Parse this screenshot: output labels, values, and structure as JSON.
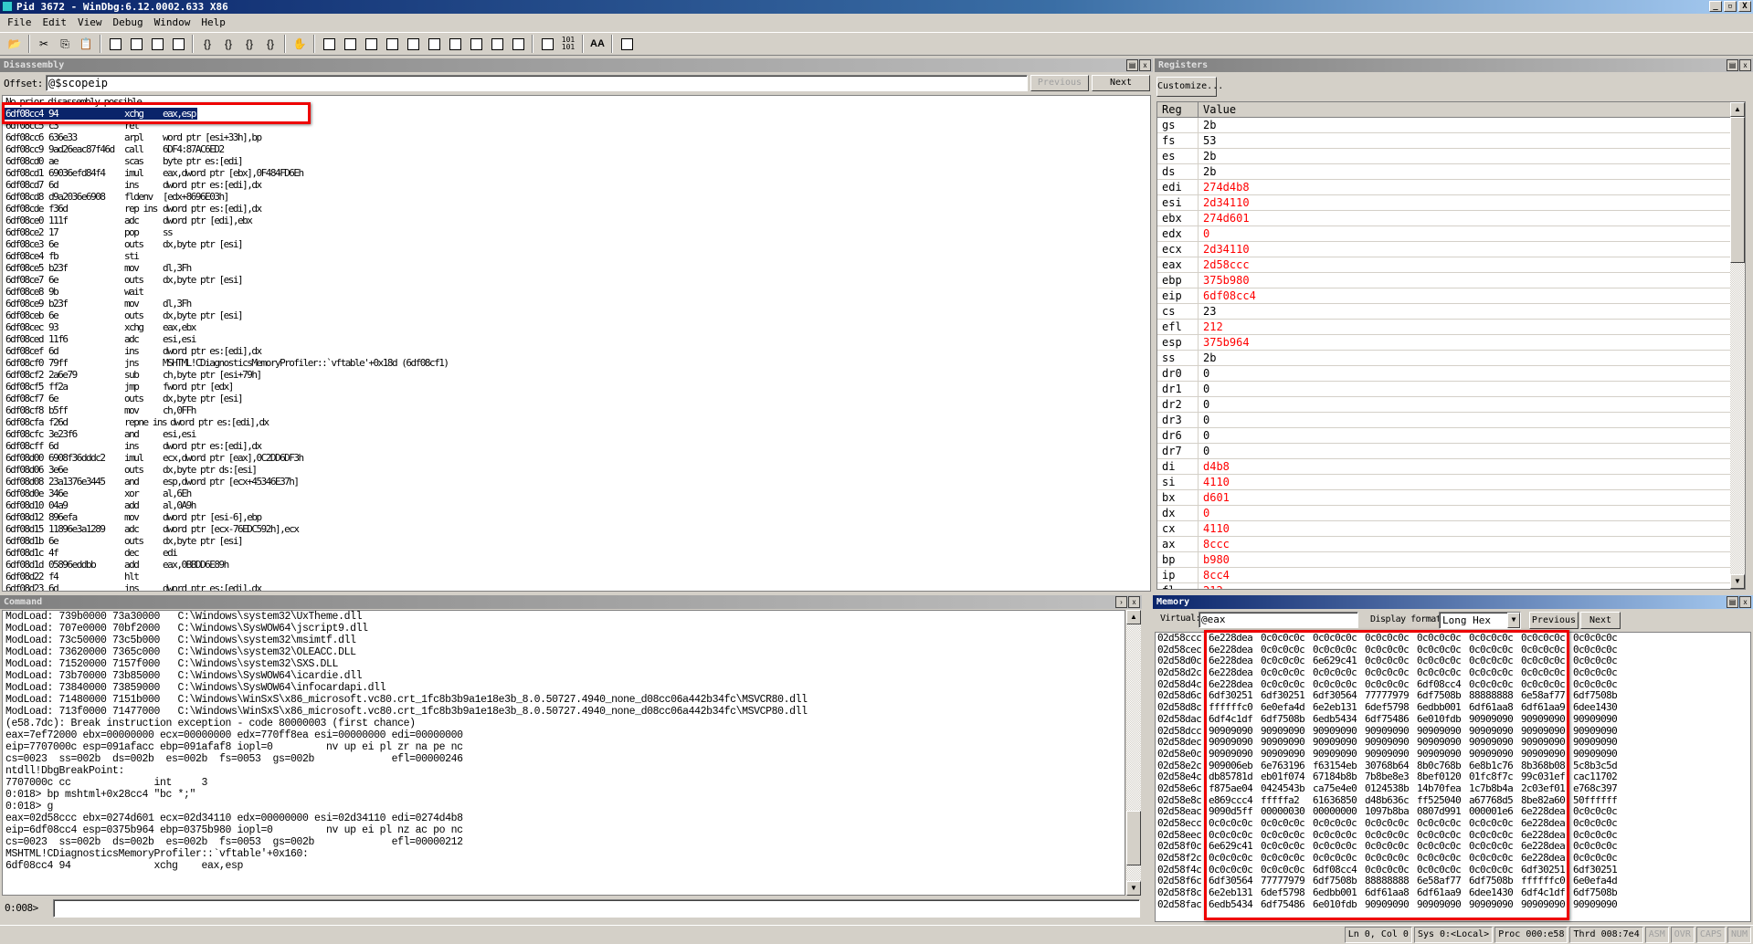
{
  "window": {
    "title": "Pid 3672 - WinDbg:6.12.0002.633 X86",
    "controls": [
      "_",
      "▫",
      "X"
    ]
  },
  "menu": [
    "File",
    "Edit",
    "View",
    "Debug",
    "Window",
    "Help"
  ],
  "toolbar": {
    "icons": [
      "open-icon",
      "|",
      "cut-icon",
      "copy-icon",
      "paste-icon",
      "|",
      "go-icon",
      "restart-icon",
      "stop-debugging-icon",
      "break-icon",
      "|",
      "step-into-icon",
      "step-over-icon",
      "step-out-icon",
      "run-to-cursor-icon",
      "|",
      "insert-breakpoint-icon",
      "|",
      "command-window-icon",
      "watch-window-icon",
      "locals-window-icon",
      "registers-window-icon",
      "memory-window-icon",
      "call-stack-icon",
      "disassembly-window-icon",
      "scratch-pad-icon",
      "processes-threads-icon",
      "command-browser-icon",
      "|",
      "source-mode-icon",
      "hex-mode-icon",
      "|",
      "font-icon",
      "|",
      "options-icon"
    ],
    "hex_label": "101\n101",
    "font_label": "AA"
  },
  "disassembly": {
    "title": "Disassembly",
    "offset_label": "Offset:",
    "offset_value": "@$scopeip",
    "previous": "Previous",
    "next": "Next",
    "header_line": "No prior disassembly possible",
    "lines": [
      [
        "6df08cc4",
        "94",
        "xchg",
        "eax,esp"
      ],
      [
        "6df08cc5",
        "c3",
        "ret",
        ""
      ],
      [
        "6df08cc6",
        "636e33",
        "arpl",
        "word ptr [esi+33h],bp"
      ],
      [
        "6df08cc9",
        "9ad26eac87f46d",
        "call",
        "6DF4:87AC6ED2"
      ],
      [
        "6df08cd0",
        "ae",
        "scas",
        "byte ptr es:[edi]"
      ],
      [
        "6df08cd1",
        "69036efd84f4",
        "imul",
        "eax,dword ptr [ebx],0F484FD6Eh"
      ],
      [
        "6df08cd7",
        "6d",
        "ins",
        "dword ptr es:[edi],dx"
      ],
      [
        "6df08cd8",
        "d9a2036e6908",
        "fldenv",
        "[edx+8696E03h]"
      ],
      [
        "6df08cde",
        "f36d",
        "rep ins",
        "dword ptr es:[edi],dx"
      ],
      [
        "6df08ce0",
        "111f",
        "adc",
        "dword ptr [edi],ebx"
      ],
      [
        "6df08ce2",
        "17",
        "pop",
        "ss"
      ],
      [
        "6df08ce3",
        "6e",
        "outs",
        "dx,byte ptr [esi]"
      ],
      [
        "6df08ce4",
        "fb",
        "sti",
        ""
      ],
      [
        "6df08ce5",
        "b23f",
        "mov",
        "dl,3Fh"
      ],
      [
        "6df08ce7",
        "6e",
        "outs",
        "dx,byte ptr [esi]"
      ],
      [
        "6df08ce8",
        "9b",
        "wait",
        ""
      ],
      [
        "6df08ce9",
        "b23f",
        "mov",
        "dl,3Fh"
      ],
      [
        "6df08ceb",
        "6e",
        "outs",
        "dx,byte ptr [esi]"
      ],
      [
        "6df08cec",
        "93",
        "xchg",
        "eax,ebx"
      ],
      [
        "6df08ced",
        "11f6",
        "adc",
        "esi,esi"
      ],
      [
        "6df08cef",
        "6d",
        "ins",
        "dword ptr es:[edi],dx"
      ],
      [
        "6df08cf0",
        "79ff",
        "jns",
        "MSHTML!CDiagnosticsMemoryProfiler::`vftable'+0x18d (6df08cf1)"
      ],
      [
        "6df08cf2",
        "2a6e79",
        "sub",
        "ch,byte ptr [esi+79h]"
      ],
      [
        "6df08cf5",
        "ff2a",
        "jmp",
        "fword ptr [edx]"
      ],
      [
        "6df08cf7",
        "6e",
        "outs",
        "dx,byte ptr [esi]"
      ],
      [
        "6df08cf8",
        "b5ff",
        "mov",
        "ch,0FFh"
      ],
      [
        "6df08cfa",
        "f26d",
        "repne ins",
        "dword ptr es:[edi],dx"
      ],
      [
        "6df08cfc",
        "3e23f6",
        "and",
        "esi,esi"
      ],
      [
        "6df08cff",
        "6d",
        "ins",
        "dword ptr es:[edi],dx"
      ],
      [
        "6df08d00",
        "6908f36dddc2",
        "imul",
        "ecx,dword ptr [eax],0C2DD6DF3h"
      ],
      [
        "6df08d06",
        "3e6e",
        "outs",
        "dx,byte ptr ds:[esi]"
      ],
      [
        "6df08d08",
        "23a1376e3445",
        "and",
        "esp,dword ptr [ecx+45346E37h]"
      ],
      [
        "6df08d0e",
        "346e",
        "xor",
        "al,6Eh"
      ],
      [
        "6df08d10",
        "04a9",
        "add",
        "al,0A9h"
      ],
      [
        "6df08d12",
        "896efa",
        "mov",
        "dword ptr [esi-6],ebp"
      ],
      [
        "6df08d15",
        "11896e3a1289",
        "adc",
        "dword ptr [ecx-76EDC592h],ecx"
      ],
      [
        "6df08d1b",
        "6e",
        "outs",
        "dx,byte ptr [esi]"
      ],
      [
        "6df08d1c",
        "4f",
        "dec",
        "edi"
      ],
      [
        "6df08d1d",
        "05896eddbb",
        "add",
        "eax,0BBDD6E89h"
      ],
      [
        "6df08d22",
        "f4",
        "hlt",
        ""
      ],
      [
        "6df08d23",
        "6d",
        "ins",
        "dword ptr es:[edi],dx"
      ]
    ]
  },
  "registers": {
    "title": "Registers",
    "customize": "Customize...",
    "col_reg": "Reg",
    "col_value": "Value",
    "changed_color": "#ff0000",
    "rows": [
      [
        "gs",
        "2b",
        false
      ],
      [
        "fs",
        "53",
        false
      ],
      [
        "es",
        "2b",
        false
      ],
      [
        "ds",
        "2b",
        false
      ],
      [
        "edi",
        "274d4b8",
        true
      ],
      [
        "esi",
        "2d34110",
        true
      ],
      [
        "ebx",
        "274d601",
        true
      ],
      [
        "edx",
        "0",
        true
      ],
      [
        "ecx",
        "2d34110",
        true
      ],
      [
        "eax",
        "2d58ccc",
        true
      ],
      [
        "ebp",
        "375b980",
        true
      ],
      [
        "eip",
        "6df08cc4",
        true
      ],
      [
        "cs",
        "23",
        false
      ],
      [
        "efl",
        "212",
        true
      ],
      [
        "esp",
        "375b964",
        true
      ],
      [
        "ss",
        "2b",
        false
      ],
      [
        "dr0",
        "0",
        false
      ],
      [
        "dr1",
        "0",
        false
      ],
      [
        "dr2",
        "0",
        false
      ],
      [
        "dr3",
        "0",
        false
      ],
      [
        "dr6",
        "0",
        false
      ],
      [
        "dr7",
        "0",
        false
      ],
      [
        "di",
        "d4b8",
        true
      ],
      [
        "si",
        "4110",
        true
      ],
      [
        "bx",
        "d601",
        true
      ],
      [
        "dx",
        "0",
        true
      ],
      [
        "cx",
        "4110",
        true
      ],
      [
        "ax",
        "8ccc",
        true
      ],
      [
        "bp",
        "b980",
        true
      ],
      [
        "ip",
        "8cc4",
        true
      ],
      [
        "fl",
        "212",
        true
      ]
    ]
  },
  "command": {
    "title": "Command",
    "prompt": "0:008>",
    "input_value": "",
    "lines": [
      "ModLoad: 739b0000 73a30000   C:\\Windows\\system32\\UxTheme.dll",
      "ModLoad: 707e0000 70bf2000   C:\\Windows\\SysWOW64\\jscript9.dll",
      "ModLoad: 73c50000 73c5b000   C:\\Windows\\system32\\msimtf.dll",
      "ModLoad: 73620000 7365c000   C:\\Windows\\system32\\OLEACC.DLL",
      "ModLoad: 71520000 7157f000   C:\\Windows\\system32\\SXS.DLL",
      "ModLoad: 73b70000 73b85000   C:\\Windows\\SysWOW64\\icardie.dll",
      "ModLoad: 73840000 73859000   C:\\Windows\\SysWOW64\\infocardapi.dll",
      "ModLoad: 71480000 7151b000   C:\\Windows\\WinSxS\\x86_microsoft.vc80.crt_1fc8b3b9a1e18e3b_8.0.50727.4940_none_d08cc06a442b34fc\\MSVCR80.dll",
      "ModLoad: 713f0000 71477000   C:\\Windows\\WinSxS\\x86_microsoft.vc80.crt_1fc8b3b9a1e18e3b_8.0.50727.4940_none_d08cc06a442b34fc\\MSVCP80.dll",
      "(e58.7dc): Break instruction exception - code 80000003 (first chance)",
      "eax=7ef72000 ebx=00000000 ecx=00000000 edx=770ff8ea esi=00000000 edi=00000000",
      "eip=7707000c esp=091afacc ebp=091afaf8 iopl=0         nv up ei pl zr na pe nc",
      "cs=0023  ss=002b  ds=002b  es=002b  fs=0053  gs=002b             efl=00000246",
      "ntdll!DbgBreakPoint:",
      "7707000c cc              int     3",
      "0:018> bp mshtml+0x28cc4 \"bc *;\"",
      "0:018> g",
      "eax=02d58ccc ebx=0274d601 ecx=02d34110 edx=00000000 esi=02d34110 edi=0274d4b8",
      "eip=6df08cc4 esp=0375b964 ebp=0375b980 iopl=0         nv up ei pl nz ac po nc",
      "cs=0023  ss=002b  ds=002b  es=002b  fs=0053  gs=002b             efl=00000212",
      "MSHTML!CDiagnosticsMemoryProfiler::`vftable'+0x160:",
      "6df08cc4 94              xchg    eax,esp"
    ]
  },
  "memory": {
    "title": "Memory",
    "virtual_label": "Virtual:",
    "virtual_value": "@eax",
    "format_label": "Display format:",
    "format_value": "Long Hex",
    "previous": "Previous",
    "next": "Next",
    "rows": [
      [
        "02d58ccc",
        "6e228dea",
        "0c0c0c0c",
        "0c0c0c0c",
        "0c0c0c0c",
        "0c0c0c0c",
        "0c0c0c0c",
        "0c0c0c0c",
        "0c0c0c0c"
      ],
      [
        "02d58cec",
        "6e228dea",
        "0c0c0c0c",
        "0c0c0c0c",
        "0c0c0c0c",
        "0c0c0c0c",
        "0c0c0c0c",
        "0c0c0c0c",
        "0c0c0c0c"
      ],
      [
        "02d58d0c",
        "6e228dea",
        "0c0c0c0c",
        "6e629c41",
        "0c0c0c0c",
        "0c0c0c0c",
        "0c0c0c0c",
        "0c0c0c0c",
        "0c0c0c0c"
      ],
      [
        "02d58d2c",
        "6e228dea",
        "0c0c0c0c",
        "0c0c0c0c",
        "0c0c0c0c",
        "0c0c0c0c",
        "0c0c0c0c",
        "0c0c0c0c",
        "0c0c0c0c"
      ],
      [
        "02d58d4c",
        "6e228dea",
        "0c0c0c0c",
        "0c0c0c0c",
        "0c0c0c0c",
        "6df08cc4",
        "0c0c0c0c",
        "0c0c0c0c",
        "0c0c0c0c"
      ],
      [
        "02d58d6c",
        "6df30251",
        "6df30251",
        "6df30564",
        "77777979",
        "6df7508b",
        "88888888",
        "6e58af77",
        "6df7508b"
      ],
      [
        "02d58d8c",
        "ffffffc0",
        "6e0efa4d",
        "6e2eb131",
        "6def5798",
        "6edbb001",
        "6df61aa8",
        "6df61aa9",
        "6dee1430"
      ],
      [
        "02d58dac",
        "6df4c1df",
        "6df7508b",
        "6edb5434",
        "6df75486",
        "6e010fdb",
        "90909090",
        "90909090",
        "90909090"
      ],
      [
        "02d58dcc",
        "90909090",
        "90909090",
        "90909090",
        "90909090",
        "90909090",
        "90909090",
        "90909090",
        "90909090"
      ],
      [
        "02d58dec",
        "90909090",
        "90909090",
        "90909090",
        "90909090",
        "90909090",
        "90909090",
        "90909090",
        "90909090"
      ],
      [
        "02d58e0c",
        "90909090",
        "90909090",
        "90909090",
        "90909090",
        "90909090",
        "90909090",
        "90909090",
        "90909090"
      ],
      [
        "02d58e2c",
        "909006eb",
        "6e763196",
        "f63154eb",
        "30768b64",
        "8b0c768b",
        "6e8b1c76",
        "8b368b08",
        "5c8b3c5d"
      ],
      [
        "02d58e4c",
        "db85781d",
        "eb01f074",
        "67184b8b",
        "7b8be8e3",
        "8bef0120",
        "01fc8f7c",
        "99c031ef",
        "cac11702"
      ],
      [
        "02d58e6c",
        "f875ae04",
        "0424543b",
        "ca75e4e0",
        "0124538b",
        "14b70fea",
        "1c7b8b4a",
        "2c03ef01",
        "e768c397"
      ],
      [
        "02d58e8c",
        "e869ccc4",
        "fffffa2",
        "61636850",
        "d48b636c",
        "ff525040",
        "a67768d5",
        "8be82a60",
        "50ffffff"
      ],
      [
        "02d58eac",
        "9090d5ff",
        "00000030",
        "00000000",
        "1097b8ba",
        "0807d991",
        "000001e6",
        "6e228dea",
        "0c0c0c0c"
      ],
      [
        "02d58ecc",
        "0c0c0c0c",
        "0c0c0c0c",
        "0c0c0c0c",
        "0c0c0c0c",
        "0c0c0c0c",
        "0c0c0c0c",
        "6e228dea",
        "0c0c0c0c"
      ],
      [
        "02d58eec",
        "0c0c0c0c",
        "0c0c0c0c",
        "0c0c0c0c",
        "0c0c0c0c",
        "0c0c0c0c",
        "0c0c0c0c",
        "6e228dea",
        "0c0c0c0c"
      ],
      [
        "02d58f0c",
        "6e629c41",
        "0c0c0c0c",
        "0c0c0c0c",
        "0c0c0c0c",
        "0c0c0c0c",
        "0c0c0c0c",
        "6e228dea",
        "0c0c0c0c"
      ],
      [
        "02d58f2c",
        "0c0c0c0c",
        "0c0c0c0c",
        "0c0c0c0c",
        "0c0c0c0c",
        "0c0c0c0c",
        "0c0c0c0c",
        "6e228dea",
        "0c0c0c0c"
      ],
      [
        "02d58f4c",
        "0c0c0c0c",
        "0c0c0c0c",
        "6df08cc4",
        "0c0c0c0c",
        "0c0c0c0c",
        "0c0c0c0c",
        "6df30251",
        "6df30251"
      ],
      [
        "02d58f6c",
        "6df30564",
        "77777979",
        "6df7508b",
        "88888888",
        "6e58af77",
        "6df7508b",
        "ffffffc0",
        "6e0efa4d"
      ],
      [
        "02d58f8c",
        "6e2eb131",
        "6def5798",
        "6edbb001",
        "6df61aa8",
        "6df61aa9",
        "6dee1430",
        "6df4c1df",
        "6df7508b"
      ],
      [
        "02d58fac",
        "6edb5434",
        "6df75486",
        "6e010fdb",
        "90909090",
        "90909090",
        "90909090",
        "90909090",
        "90909090"
      ]
    ]
  },
  "statusbar": {
    "position": "Ln 0, Col 0",
    "sys": "Sys 0:<Local>",
    "proc": "Proc 000:e58",
    "thrd": "Thrd 008:7e4",
    "asm": "ASM",
    "ovr": "OVR",
    "caps": "CAPS",
    "num": "NUM"
  },
  "highlight_color": "#ee0000"
}
